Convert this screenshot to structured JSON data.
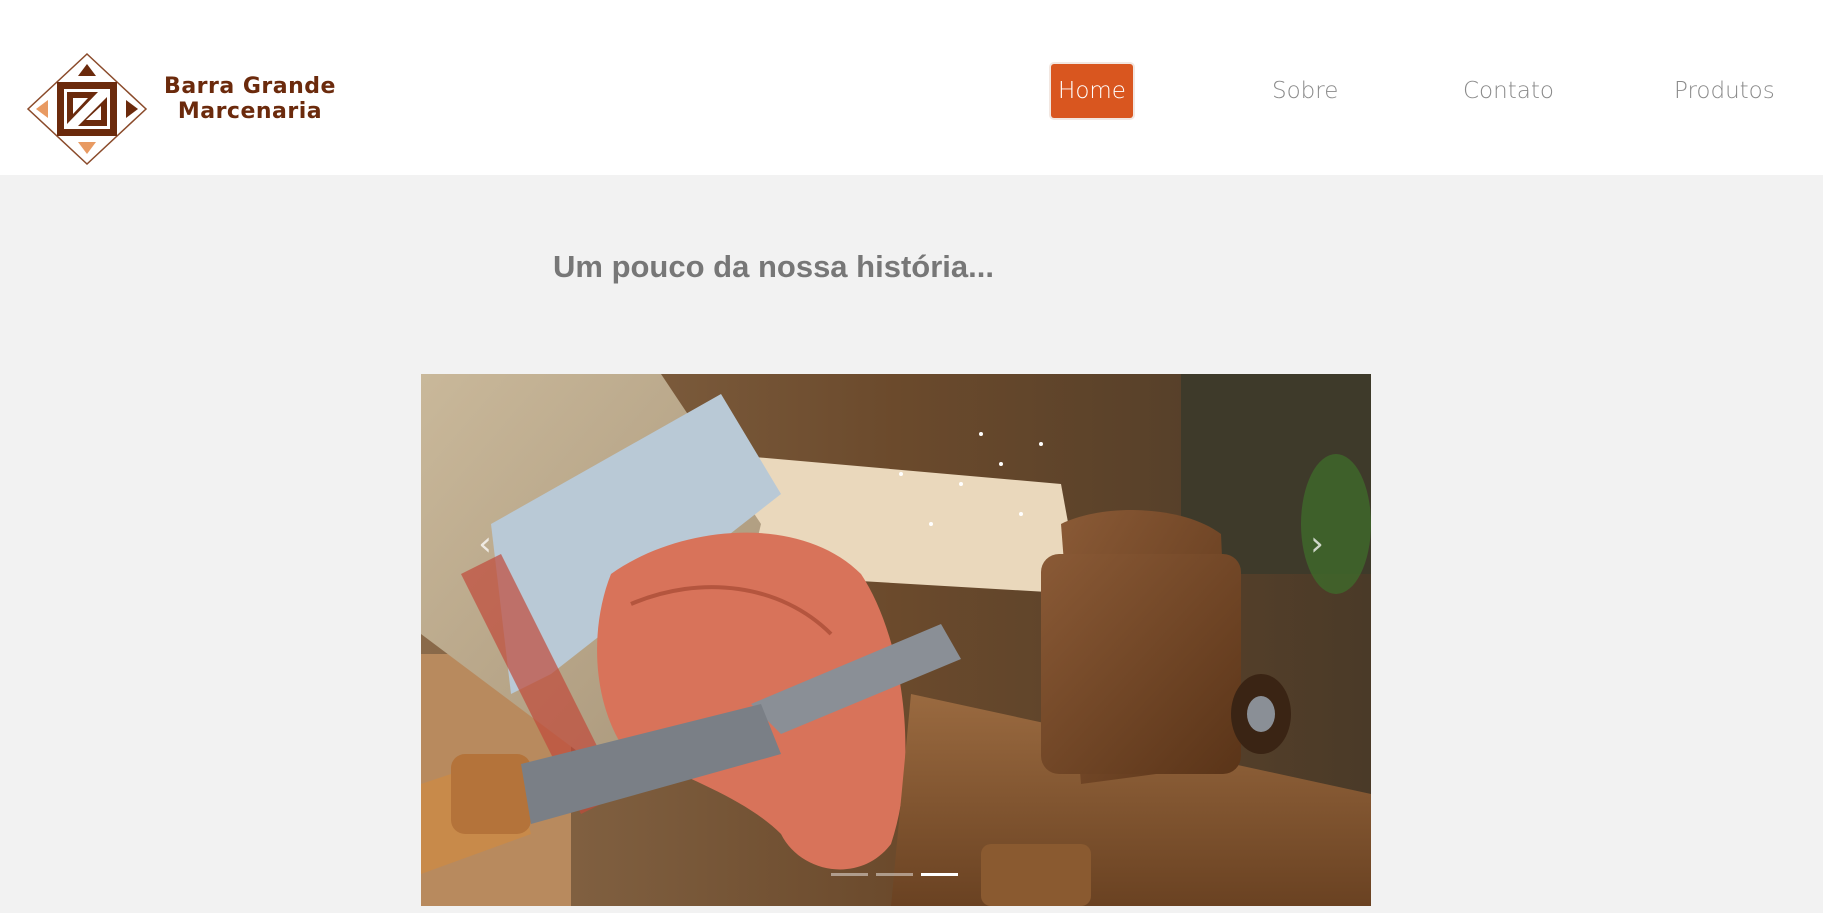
{
  "brand": {
    "line1": "Barra Grande",
    "line2": "Marcenaria",
    "logo_icon": "diamond-logo-icon"
  },
  "nav": {
    "home": "Home",
    "sobre": "Sobre",
    "contato": "Contato",
    "produtos": "Produtos",
    "active": "Home"
  },
  "main": {
    "headline": "Um pouco da nossa história..."
  },
  "carousel": {
    "prev_icon": "‹",
    "next_icon": "›",
    "slide_count": 3,
    "active_slide": 3,
    "image_alt": "woodworker hand holding chisel on lathe"
  },
  "colors": {
    "accent": "#d9561f",
    "brand": "#6b2a0c",
    "logo_light": "#e89a62",
    "background": "#f2f2f2"
  }
}
